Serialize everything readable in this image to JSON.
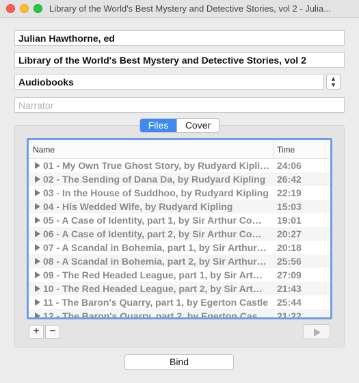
{
  "window": {
    "title": "Library of the World's Best Mystery and Detective Stories, vol 2 - Julia..."
  },
  "fields": {
    "author": "Julian Hawthorne, ed",
    "title": "Library of the World's Best Mystery and Detective Stories, vol 2",
    "genre": "Audiobooks",
    "narrator_placeholder": "Narrator"
  },
  "tabs": [
    {
      "label": "Files",
      "active": true
    },
    {
      "label": "Cover",
      "active": false
    }
  ],
  "table": {
    "columns": {
      "name": "Name",
      "time": "Time"
    },
    "rows": [
      {
        "name": "01 - My Own True Ghost Story, by Rudyard Kipling",
        "time": "24:06"
      },
      {
        "name": "02 - The Sending of Dana Da, by Rudyard Kipling",
        "time": "26:42"
      },
      {
        "name": "03 - In the House of Suddhoo, by Rudyard Kipling",
        "time": "22:19"
      },
      {
        "name": "04 - His Wedded Wife, by Rudyard Kipling",
        "time": "15:03"
      },
      {
        "name": "05 - A Case of Identity, part 1, by Sir Arthur Co…",
        "time": "19:01"
      },
      {
        "name": "06 - A Case of Identity, part 2, by Sir Arthur Co…",
        "time": "20:27"
      },
      {
        "name": "07 - A Scandal in Bohemia, part 1, by Sir Arthur…",
        "time": "20:18"
      },
      {
        "name": "08 - A Scandal in Bohemia, part 2, by Sir Arthur…",
        "time": "25:56"
      },
      {
        "name": "09 - The Red Headed League, part 1, by Sir Art…",
        "time": "27:09"
      },
      {
        "name": "10 - The Red Headed League, part 2, by Sir Art…",
        "time": "21:43"
      },
      {
        "name": "11 - The Baron's Quarry, part 1, by Egerton Castle",
        "time": "25:44"
      },
      {
        "name": "12 - The Baron's Quarry, part 2, by Egerton Cas…",
        "time": "21:22"
      }
    ]
  },
  "controls": {
    "add": "+",
    "remove": "−",
    "stepper": "⌃⌄",
    "bind": "Bind"
  },
  "colors": {
    "accent": "#3b8bf0",
    "table_focus": "#6f9ee6"
  }
}
